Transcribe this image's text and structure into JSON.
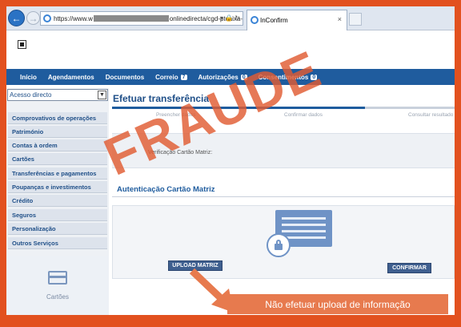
{
  "browser": {
    "url_start": "https://www.w",
    "url_end": "onlinedirecta/cgd-ptcaixa-",
    "url_controls": "▾ 🔒 ↻",
    "tab_title": "InConfirm",
    "tab_close": "×"
  },
  "topnav": {
    "items": [
      {
        "label": "Início"
      },
      {
        "label": "Agendamentos"
      },
      {
        "label": "Documentos"
      },
      {
        "label": "Correio",
        "badge": "7"
      },
      {
        "label": "Autorizações",
        "badge": "0"
      },
      {
        "label": "Consentimentos",
        "badge": "0"
      }
    ]
  },
  "sidebar": {
    "select_value": "Acesso directo",
    "items": [
      "Comprovativos de operações",
      "Património",
      "Contas à ordem",
      "Cartões",
      "Transferências e pagamentos",
      "Poupanças e investimentos",
      "Crédito",
      "Seguros",
      "Personalização",
      "Outros Serviços"
    ],
    "cards_label": "Cartões"
  },
  "content": {
    "title": "Efetuar transferência",
    "steps": [
      "Preencher dados",
      "Confirmar dados",
      "Consultar resultado"
    ],
    "verification_text": "Verificação Cartão Matriz:",
    "section_title": "Autenticação Cartão Matriz",
    "upload_button": "UPLOAD MATRIZ",
    "confirm_button": "CONFIRMAR"
  },
  "overlay": {
    "stamp": "FRAUDE",
    "warning": "Não efetuar upload de informação"
  },
  "colors": {
    "frame": "#e2511f",
    "nav": "#1f5c9e",
    "stamp": "#e05c32",
    "warning_bg": "#e77a4e"
  }
}
